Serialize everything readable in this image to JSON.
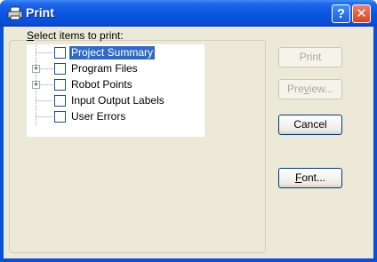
{
  "window": {
    "title": "Print",
    "help_glyph": "?",
    "close_glyph": "✕",
    "title_icon": "printer-icon"
  },
  "group": {
    "label_pre": "",
    "label_mnemonic": "S",
    "label_post": "elect items to print:"
  },
  "tree": {
    "items": [
      {
        "label": "Project Summary",
        "expandable": false,
        "checked": false,
        "selected": true
      },
      {
        "label": "Program Files",
        "expandable": true,
        "checked": false,
        "selected": false
      },
      {
        "label": "Robot Points",
        "expandable": true,
        "checked": false,
        "selected": false
      },
      {
        "label": "Input Output Labels",
        "expandable": false,
        "checked": false,
        "selected": false
      },
      {
        "label": "User Errors",
        "expandable": false,
        "checked": false,
        "selected": false
      }
    ],
    "expander_glyph": "+"
  },
  "buttons": {
    "print": {
      "label": "Print",
      "enabled": false
    },
    "preview": {
      "pre": "Pre",
      "mnemonic": "v",
      "post": "iew...",
      "enabled": false
    },
    "cancel": {
      "label": "Cancel",
      "enabled": true
    },
    "font": {
      "pre": "",
      "mnemonic": "F",
      "post": "ont...",
      "enabled": true
    }
  },
  "colors": {
    "titlebar": "#0a56e0",
    "selection": "#316ac5",
    "dialog_bg": "#ece9d8"
  }
}
